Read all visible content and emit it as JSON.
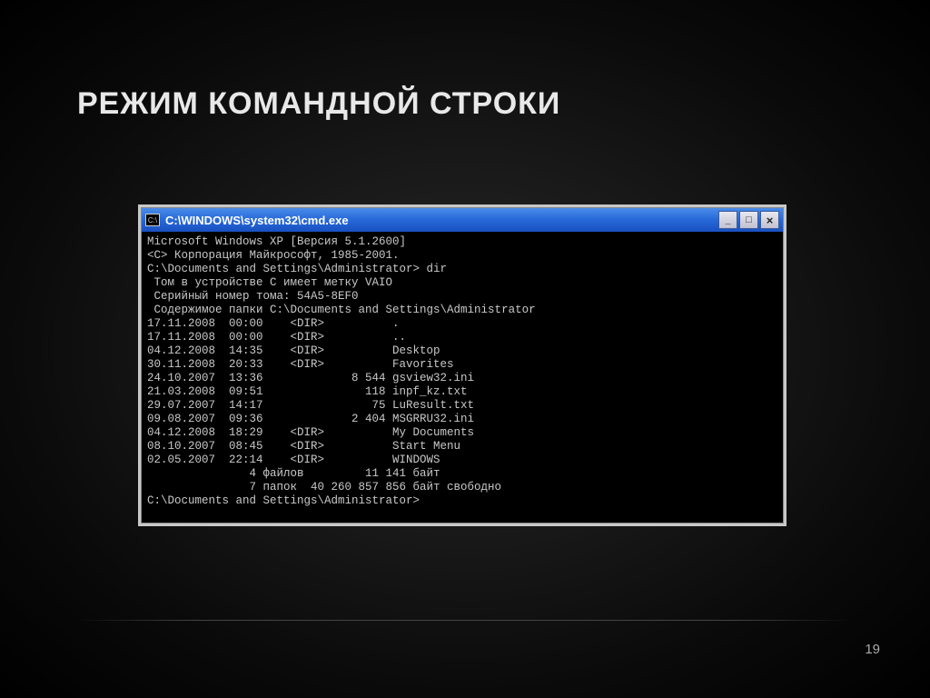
{
  "slide": {
    "title": "РЕЖИМ КОМАНДНОЙ СТРОКИ",
    "page_number": "19"
  },
  "window": {
    "icon_text": "C:\\",
    "title": "C:\\WINDOWS\\system32\\cmd.exe",
    "controls": {
      "minimize": "_",
      "maximize": "□",
      "close": "×"
    }
  },
  "terminal": {
    "lines": [
      "Microsoft Windows XP [Версия 5.1.2600]",
      "<C> Корпорация Майкрософт, 1985-2001.",
      "",
      "C:\\Documents and Settings\\Administrator> dir",
      " Том в устройстве C имеет метку VAIO",
      " Серийный номер тома: 54A5-8EF0",
      "",
      " Содержимое папки C:\\Documents and Settings\\Administrator",
      "",
      "17.11.2008  00:00    <DIR>          .",
      "17.11.2008  00:00    <DIR>          ..",
      "04.12.2008  14:35    <DIR>          Desktop",
      "30.11.2008  20:33    <DIR>          Favorites",
      "24.10.2007  13:36             8 544 gsview32.ini",
      "21.03.2008  09:51               118 inpf_kz.txt",
      "29.07.2007  14:17                75 LuResult.txt",
      "09.08.2007  09:36             2 404 MSGRRU32.ini",
      "04.12.2008  18:29    <DIR>          My Documents",
      "08.10.2007  08:45    <DIR>          Start Menu",
      "02.05.2007  22:14    <DIR>          WINDOWS",
      "               4 файлов         11 141 байт",
      "               7 папок  40 260 857 856 байт свободно",
      "",
      "C:\\Documents and Settings\\Administrator>"
    ]
  }
}
